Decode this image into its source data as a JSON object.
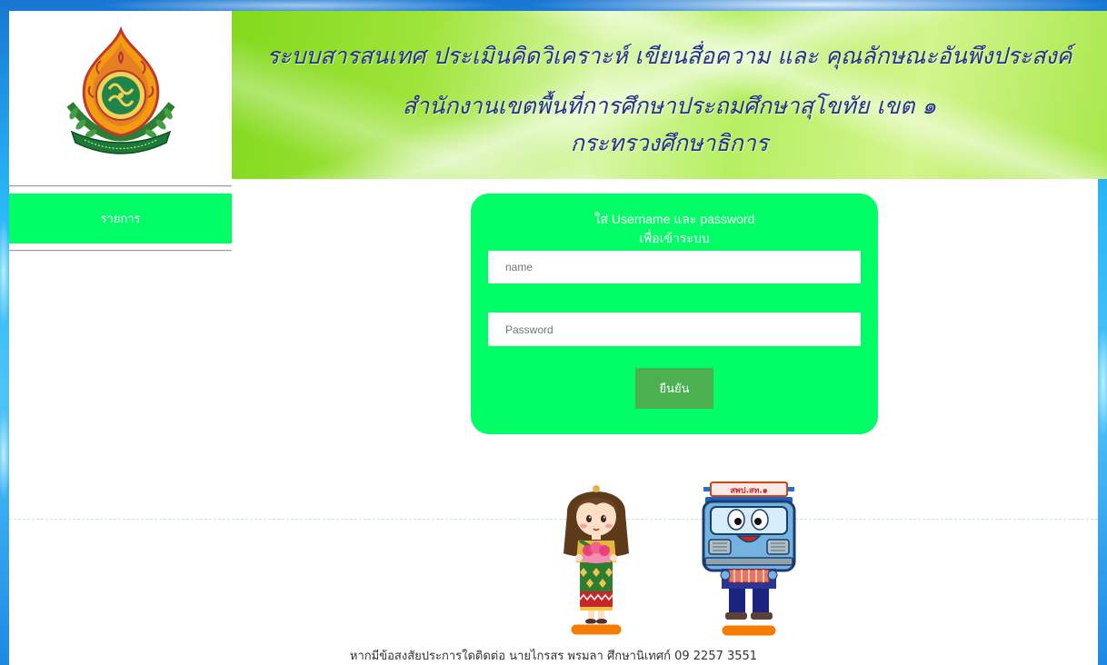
{
  "logo": {
    "icon": "obec-emblem-icon"
  },
  "banner": {
    "line1": "ระบบสารสนเทศ ประเมินคิดวิเคราะห์ เขียนสื่อความ และ คุณลักษณะอันพึงประสงค์",
    "line2": "สำนักงานเขตพื้นที่การศึกษาประถมศึกษาสุโขทัย เขต ๑",
    "line3": "กระทรวงศึกษาธิการ"
  },
  "sidebar": {
    "menu_label": "รายการ"
  },
  "login": {
    "title_line1": "ใส่ Username และ password",
    "title_line2": "เพื่อเข้าระบบ",
    "username": {
      "placeholder": "name",
      "value": ""
    },
    "password": {
      "placeholder": "Password",
      "value": ""
    },
    "submit_label": "ยืนยัน"
  },
  "mascots": {
    "left_icon": "girl-mascot-icon",
    "right_icon": "bus-mascot-icon",
    "bus_sign": "สพป.สท.๑"
  },
  "footer": {
    "contact_text": "หากมีข้อสงสัยประการใดติดต่อ นายไกรสร พรมลา ศึกษานิเทศก์ 09 2257 3551"
  },
  "colors": {
    "accent_green": "#00ff66",
    "button_green": "#4caf50",
    "banner_text": "#27318a",
    "frame_blue": "#1e88e5"
  }
}
